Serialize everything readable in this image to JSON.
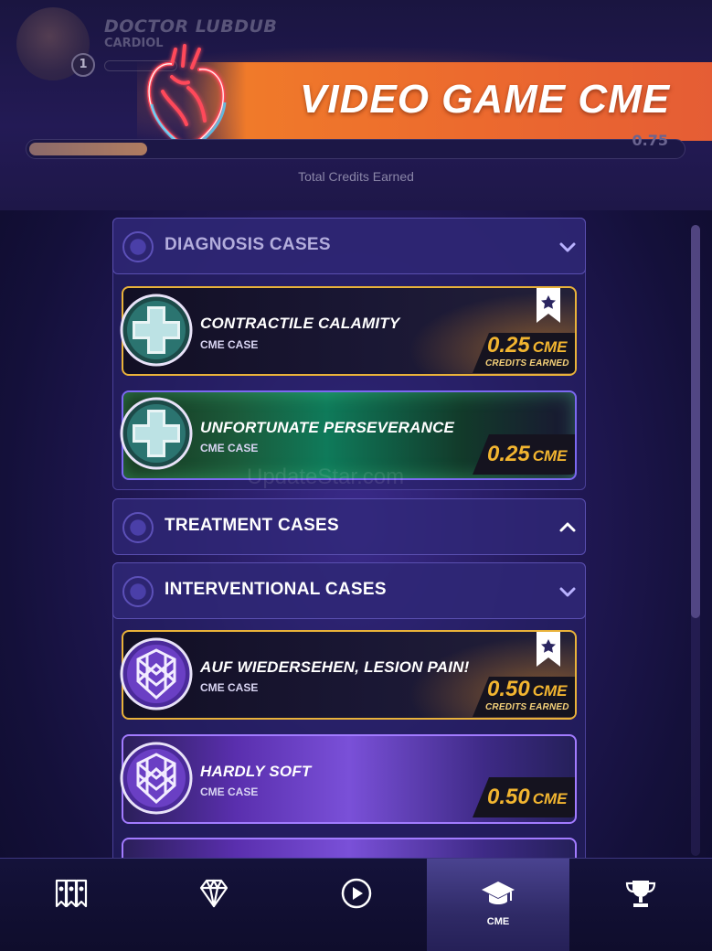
{
  "header": {
    "title": "VIDEO GAME CME",
    "profile_name": "DOCTOR LUBDUB",
    "profile_subtitle": "CARDIOL",
    "profile_level": "1",
    "credits_total": "0.75",
    "credits_label": "Total Credits Earned",
    "credits_progress": 0.18
  },
  "sections": [
    {
      "title": "DIAGNOSIS CASES",
      "expanded": true
    },
    {
      "title": "TREATMENT CASES",
      "expanded": false
    },
    {
      "title": "INTERVENTIONAL CASES",
      "expanded": true
    }
  ],
  "cases": [
    {
      "name": "CONTRACTILE CALAMITY",
      "type": "CME CASE",
      "credits": "0.25",
      "unit": "CME",
      "earned_label": "CREDITS EARNED",
      "earned": true
    },
    {
      "name": "UNFORTUNATE PERSEVERANCE",
      "type": "CME CASE",
      "credits": "0.25",
      "unit": "CME",
      "earned": false
    },
    {
      "name": "AUF WIEDERSEHEN, LESION PAIN!",
      "type": "CME CASE",
      "credits": "0.50",
      "unit": "CME",
      "earned_label": "CREDITS EARNED",
      "earned": true
    },
    {
      "name": "HARDLY SOFT",
      "type": "CME CASE",
      "credits": "0.50",
      "unit": "CME",
      "earned": false
    }
  ],
  "watermark": "UpdateStar.com",
  "nav": [
    {
      "icon": "badges-icon",
      "label": ""
    },
    {
      "icon": "diamond-icon",
      "label": ""
    },
    {
      "icon": "play-icon",
      "label": ""
    },
    {
      "icon": "graduation-cap-icon",
      "label": "CME",
      "active": true
    },
    {
      "icon": "trophy-icon",
      "label": ""
    }
  ],
  "colors": {
    "accent_orange": "#f07a2a",
    "gold": "#f2b530",
    "purple_border": "#a27bff",
    "panel": "#30287a"
  }
}
